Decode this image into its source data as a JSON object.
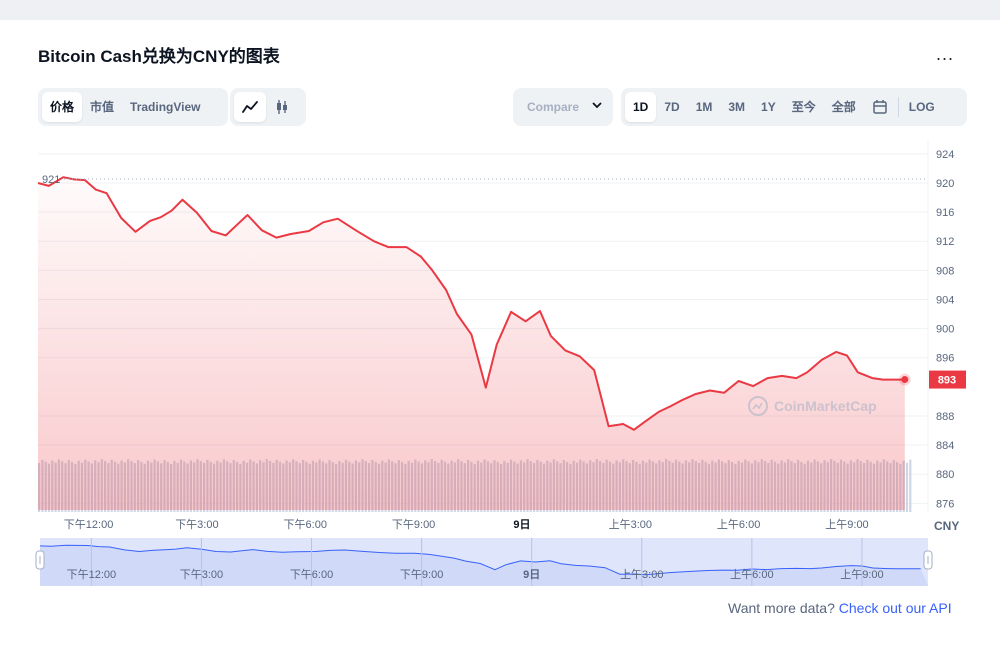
{
  "header": {
    "title": "Bitcoin Cash兑换为CNY的图表",
    "more": "..."
  },
  "tabs": {
    "price": "价格",
    "market_cap": "市值",
    "tradingview": "TradingView"
  },
  "compare": {
    "label": "Compare"
  },
  "ranges": [
    "1D",
    "7D",
    "1M",
    "3M",
    "1Y",
    "至今",
    "全部"
  ],
  "log_label": "LOG",
  "watermark": "CoinMarketCap",
  "footer": {
    "text": "Want more data?",
    "link": "Check out our API"
  },
  "colors": {
    "line": "#ea3943",
    "accent": "#3861fb",
    "volume": "#cfd6e4",
    "nav_fill": "#dfe5fb"
  },
  "chart_data": {
    "type": "line",
    "currency": "CNY",
    "yticks": [
      924,
      920,
      916,
      912,
      908,
      904,
      900,
      896,
      888,
      884,
      880,
      876
    ],
    "ylim": [
      876,
      925
    ],
    "open_price_label": "921",
    "last_price_label": "893",
    "x_labels": [
      "下午12:00",
      "下午3:00",
      "下午6:00",
      "下午9:00",
      "9日",
      "上午3:00",
      "上午6:00",
      "上午9:00"
    ],
    "x_label_hours": [
      12,
      15,
      18,
      21,
      24,
      27,
      30,
      33
    ],
    "x_range_hours": [
      10.6,
      34.8
    ],
    "series": [
      {
        "values_x_hours": [
          10.6,
          10.9,
          11.3,
          11.6,
          11.9,
          12.2,
          12.5,
          12.9,
          13.3,
          13.7,
          14.0,
          14.3,
          14.6,
          15.0,
          15.4,
          15.8,
          16.1,
          16.4,
          16.8,
          17.2,
          17.6,
          18.1,
          18.5,
          18.9,
          19.4,
          19.9,
          20.3,
          20.8,
          21.2,
          21.5,
          21.9,
          22.2,
          22.6,
          23.0,
          23.3,
          23.7,
          24.1,
          24.5,
          24.8,
          25.2,
          25.6,
          26.0,
          26.4,
          26.8,
          27.1,
          27.4,
          27.8,
          28.1,
          28.4,
          28.8,
          29.2,
          29.6,
          30.0,
          30.4,
          30.8,
          31.2,
          31.6,
          31.9,
          32.3,
          32.7,
          33.0,
          33.3,
          33.7,
          34.0,
          34.3,
          34.6
        ],
        "values": [
          920.0,
          919.6,
          920.8,
          920.5,
          920.4,
          919.1,
          918.6,
          915.2,
          913.3,
          914.8,
          915.3,
          916.2,
          917.7,
          915.9,
          913.4,
          912.8,
          914.2,
          915.6,
          913.5,
          912.5,
          913.0,
          913.4,
          914.6,
          915.1,
          913.5,
          912.0,
          911.2,
          911.2,
          909.9,
          908.1,
          905.3,
          902.0,
          899.2,
          891.9,
          897.8,
          902.3,
          901.0,
          902.4,
          899.0,
          897.0,
          896.2,
          894.3,
          886.6,
          886.9,
          886.1,
          887.2,
          888.6,
          889.3,
          890.1,
          891.0,
          891.5,
          891.2,
          892.8,
          892.1,
          893.2,
          893.5,
          893.2,
          894.0,
          895.7,
          896.8,
          896.3,
          894.0,
          893.2,
          893.0,
          893.0,
          893.0
        ]
      }
    ],
    "volume_present": true,
    "grid": true
  }
}
